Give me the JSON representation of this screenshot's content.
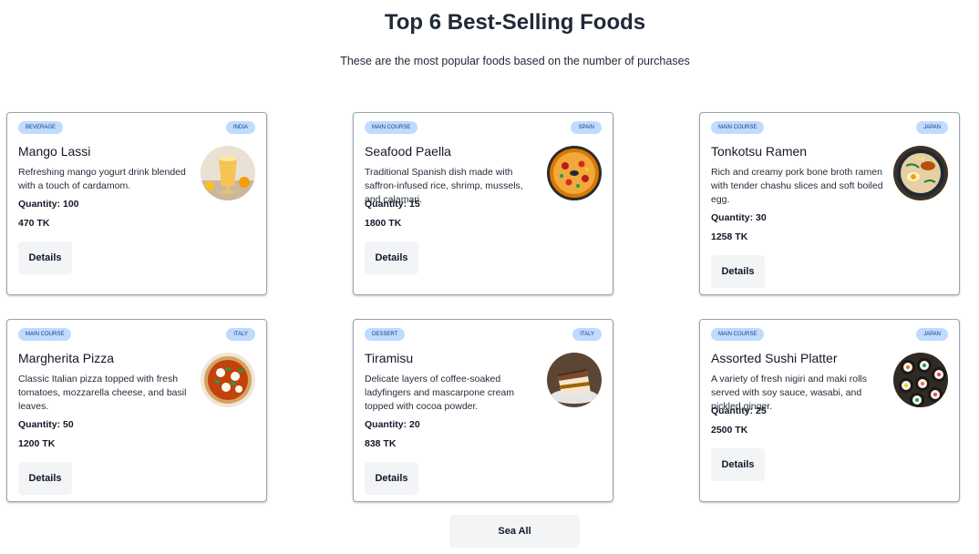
{
  "header": {
    "title": "Top 6 Best-Selling Foods",
    "subtitle": "These are the most popular foods based on the number of purchases"
  },
  "foods": [
    {
      "category": "Beverage",
      "origin": "India",
      "name": "Mango Lassi",
      "description": "Refreshing mango yogurt drink blended with a touch of cardamom.",
      "quantity": "Quantity: 100",
      "price": "470 TK",
      "details_label": "Details",
      "image_icon": "mango-lassi-image"
    },
    {
      "category": "Main Course",
      "origin": "Spain",
      "name": "Seafood Paella",
      "description": "Traditional Spanish dish made with saffron-infused rice, shrimp, mussels, and calamari.",
      "quantity": "Quantity: 15",
      "price": "1800 TK",
      "details_label": "Details",
      "image_icon": "seafood-paella-image"
    },
    {
      "category": "Main Course",
      "origin": "Japan",
      "name": "Tonkotsu Ramen",
      "description": "Rich and creamy pork bone broth ramen with tender chashu slices and soft boiled egg.",
      "quantity": "Quantity: 30",
      "price": "1258 TK",
      "details_label": "Details",
      "image_icon": "tonkotsu-ramen-image"
    },
    {
      "category": "Main Course",
      "origin": "Italy",
      "name": "Margherita Pizza",
      "description": "Classic Italian pizza topped with fresh tomatoes, mozzarella cheese, and basil leaves.",
      "quantity": "Quantity: 50",
      "price": "1200 TK",
      "details_label": "Details",
      "image_icon": "margherita-pizza-image"
    },
    {
      "category": "Dessert",
      "origin": "Italy",
      "name": "Tiramisu",
      "description": "Delicate layers of coffee-soaked ladyfingers and mascarpone cream topped with cocoa powder.",
      "quantity": "Quantity: 20",
      "price": "838 TK",
      "details_label": "Details",
      "image_icon": "tiramisu-image"
    },
    {
      "category": "Main Course",
      "origin": "Japan",
      "name": "Assorted Sushi Platter",
      "description": "A variety of fresh nigiri and maki rolls served with soy sauce, wasabi, and pickled ginger.",
      "quantity": "Quantity: 25",
      "price": "2500 TK",
      "details_label": "Details",
      "image_icon": "sushi-platter-image"
    }
  ],
  "footer": {
    "see_all_label": "Sea All"
  },
  "colors": {
    "badge_bg": "#bfdbfe",
    "button_bg": "#f3f4f6",
    "card_border": "#9ca3af"
  }
}
